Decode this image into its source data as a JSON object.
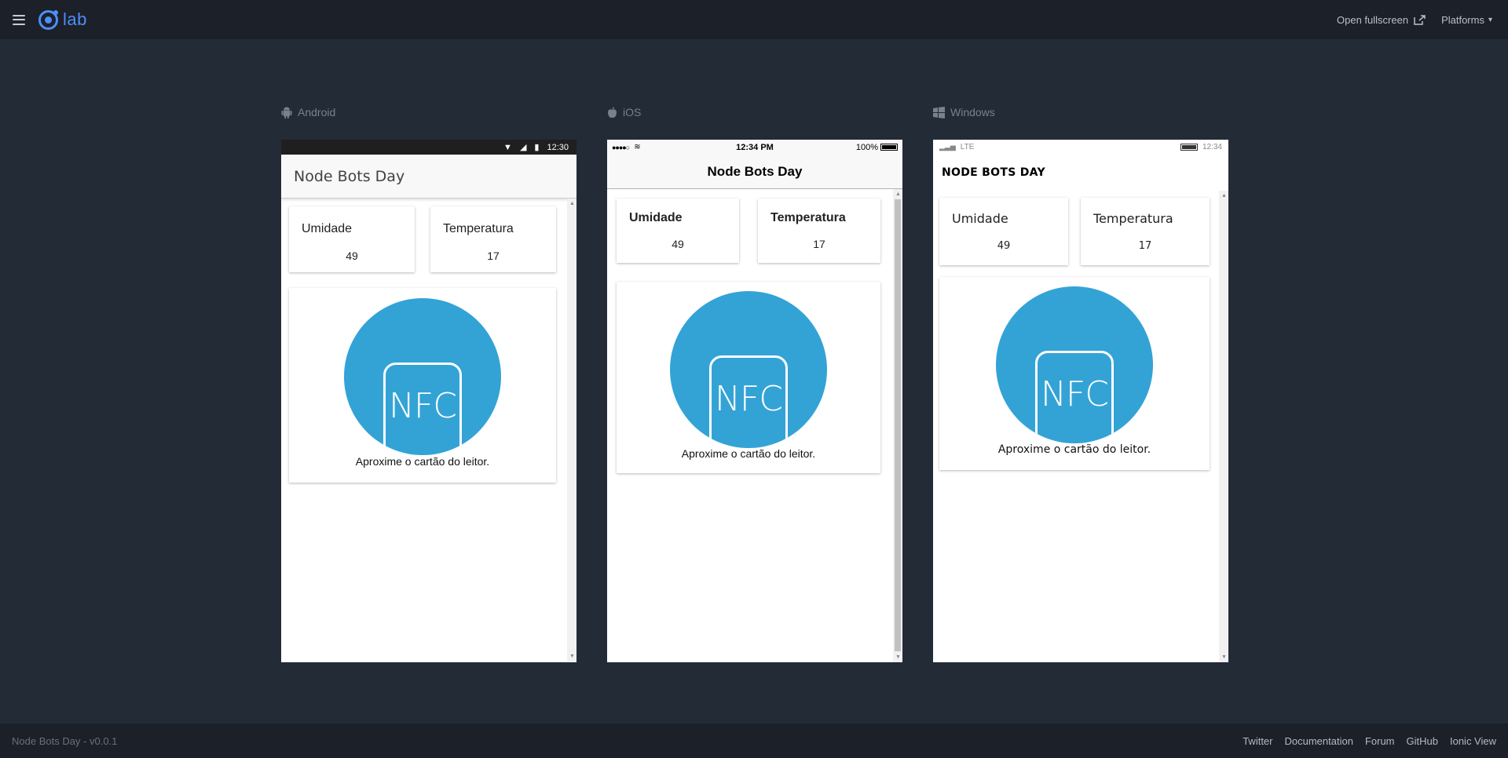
{
  "topbar": {
    "logo_text": "lab",
    "fullscreen_label": "Open fullscreen",
    "platforms_label": "Platforms"
  },
  "devices": {
    "android": {
      "label": "Android",
      "status_time": "12:30",
      "title": "Node Bots Day"
    },
    "ios": {
      "label": "iOS",
      "status_time": "12:34 PM",
      "status_battery": "100%",
      "title": "Node Bots Day"
    },
    "windows": {
      "label": "Windows",
      "status_network": "LTE",
      "status_time": "12:34",
      "title": "NODE BOTS DAY"
    }
  },
  "app": {
    "humidity_label": "Umidade",
    "humidity_value": "49",
    "temperature_label": "Temperatura",
    "temperature_value": "17",
    "nfc_text": "NFC",
    "nfc_caption": "Aproxime o cartão do leitor."
  },
  "colors": {
    "background": "#232b36",
    "bar": "#1b2029",
    "accent": "#4e8ef7",
    "nfc_blue": "#33a3d6"
  },
  "footer": {
    "version": "Node Bots Day - v0.0.1",
    "links": [
      "Twitter",
      "Documentation",
      "Forum",
      "GitHub",
      "Ionic View"
    ]
  }
}
